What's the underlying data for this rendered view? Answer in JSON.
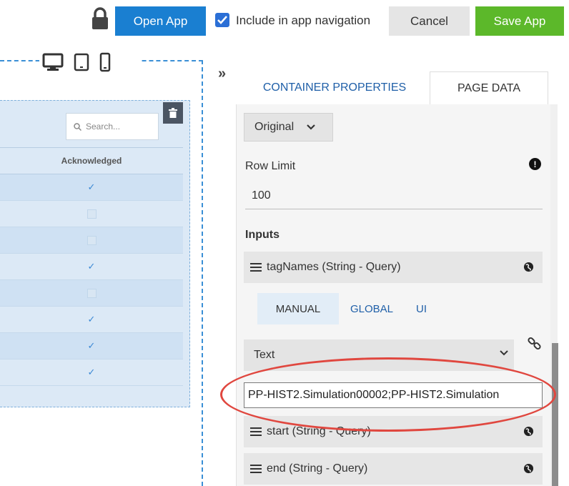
{
  "toolbar": {
    "lock_icon": "lock-icon",
    "open_app": "Open App",
    "include_nav_label": "Include in app navigation",
    "include_nav_checked": true,
    "cancel": "Cancel",
    "save_app": "Save App",
    "colors": {
      "primary": "#1a7fd1",
      "save": "#5cb82a"
    }
  },
  "canvas": {
    "devices": [
      "desktop-icon",
      "tablet-icon",
      "mobile-icon"
    ],
    "search_placeholder": "Search...",
    "column_header": "Acknowledged",
    "rows": [
      true,
      false,
      false,
      true,
      false,
      true,
      true,
      true
    ]
  },
  "panel": {
    "expand_glyph": "»",
    "tabs": [
      "CONTAINER PROPERTIES",
      "PAGE DATA"
    ],
    "active_tab": "PAGE DATA",
    "datasource_mode": "Original",
    "row_limit_label": "Row Limit",
    "row_limit_value": "100",
    "inputs_label": "Inputs",
    "params": [
      {
        "label": "tagNames (String - Query)"
      },
      {
        "label": "start (String - Query)"
      },
      {
        "label": "end (String - Query)"
      }
    ],
    "source_tabs": [
      "MANUAL",
      "GLOBAL",
      "UI"
    ],
    "active_source_tab": "MANUAL",
    "value_type": "Text",
    "tag_value": "PP-HIST2.Simulation00002;PP-HIST2.Simulation"
  }
}
